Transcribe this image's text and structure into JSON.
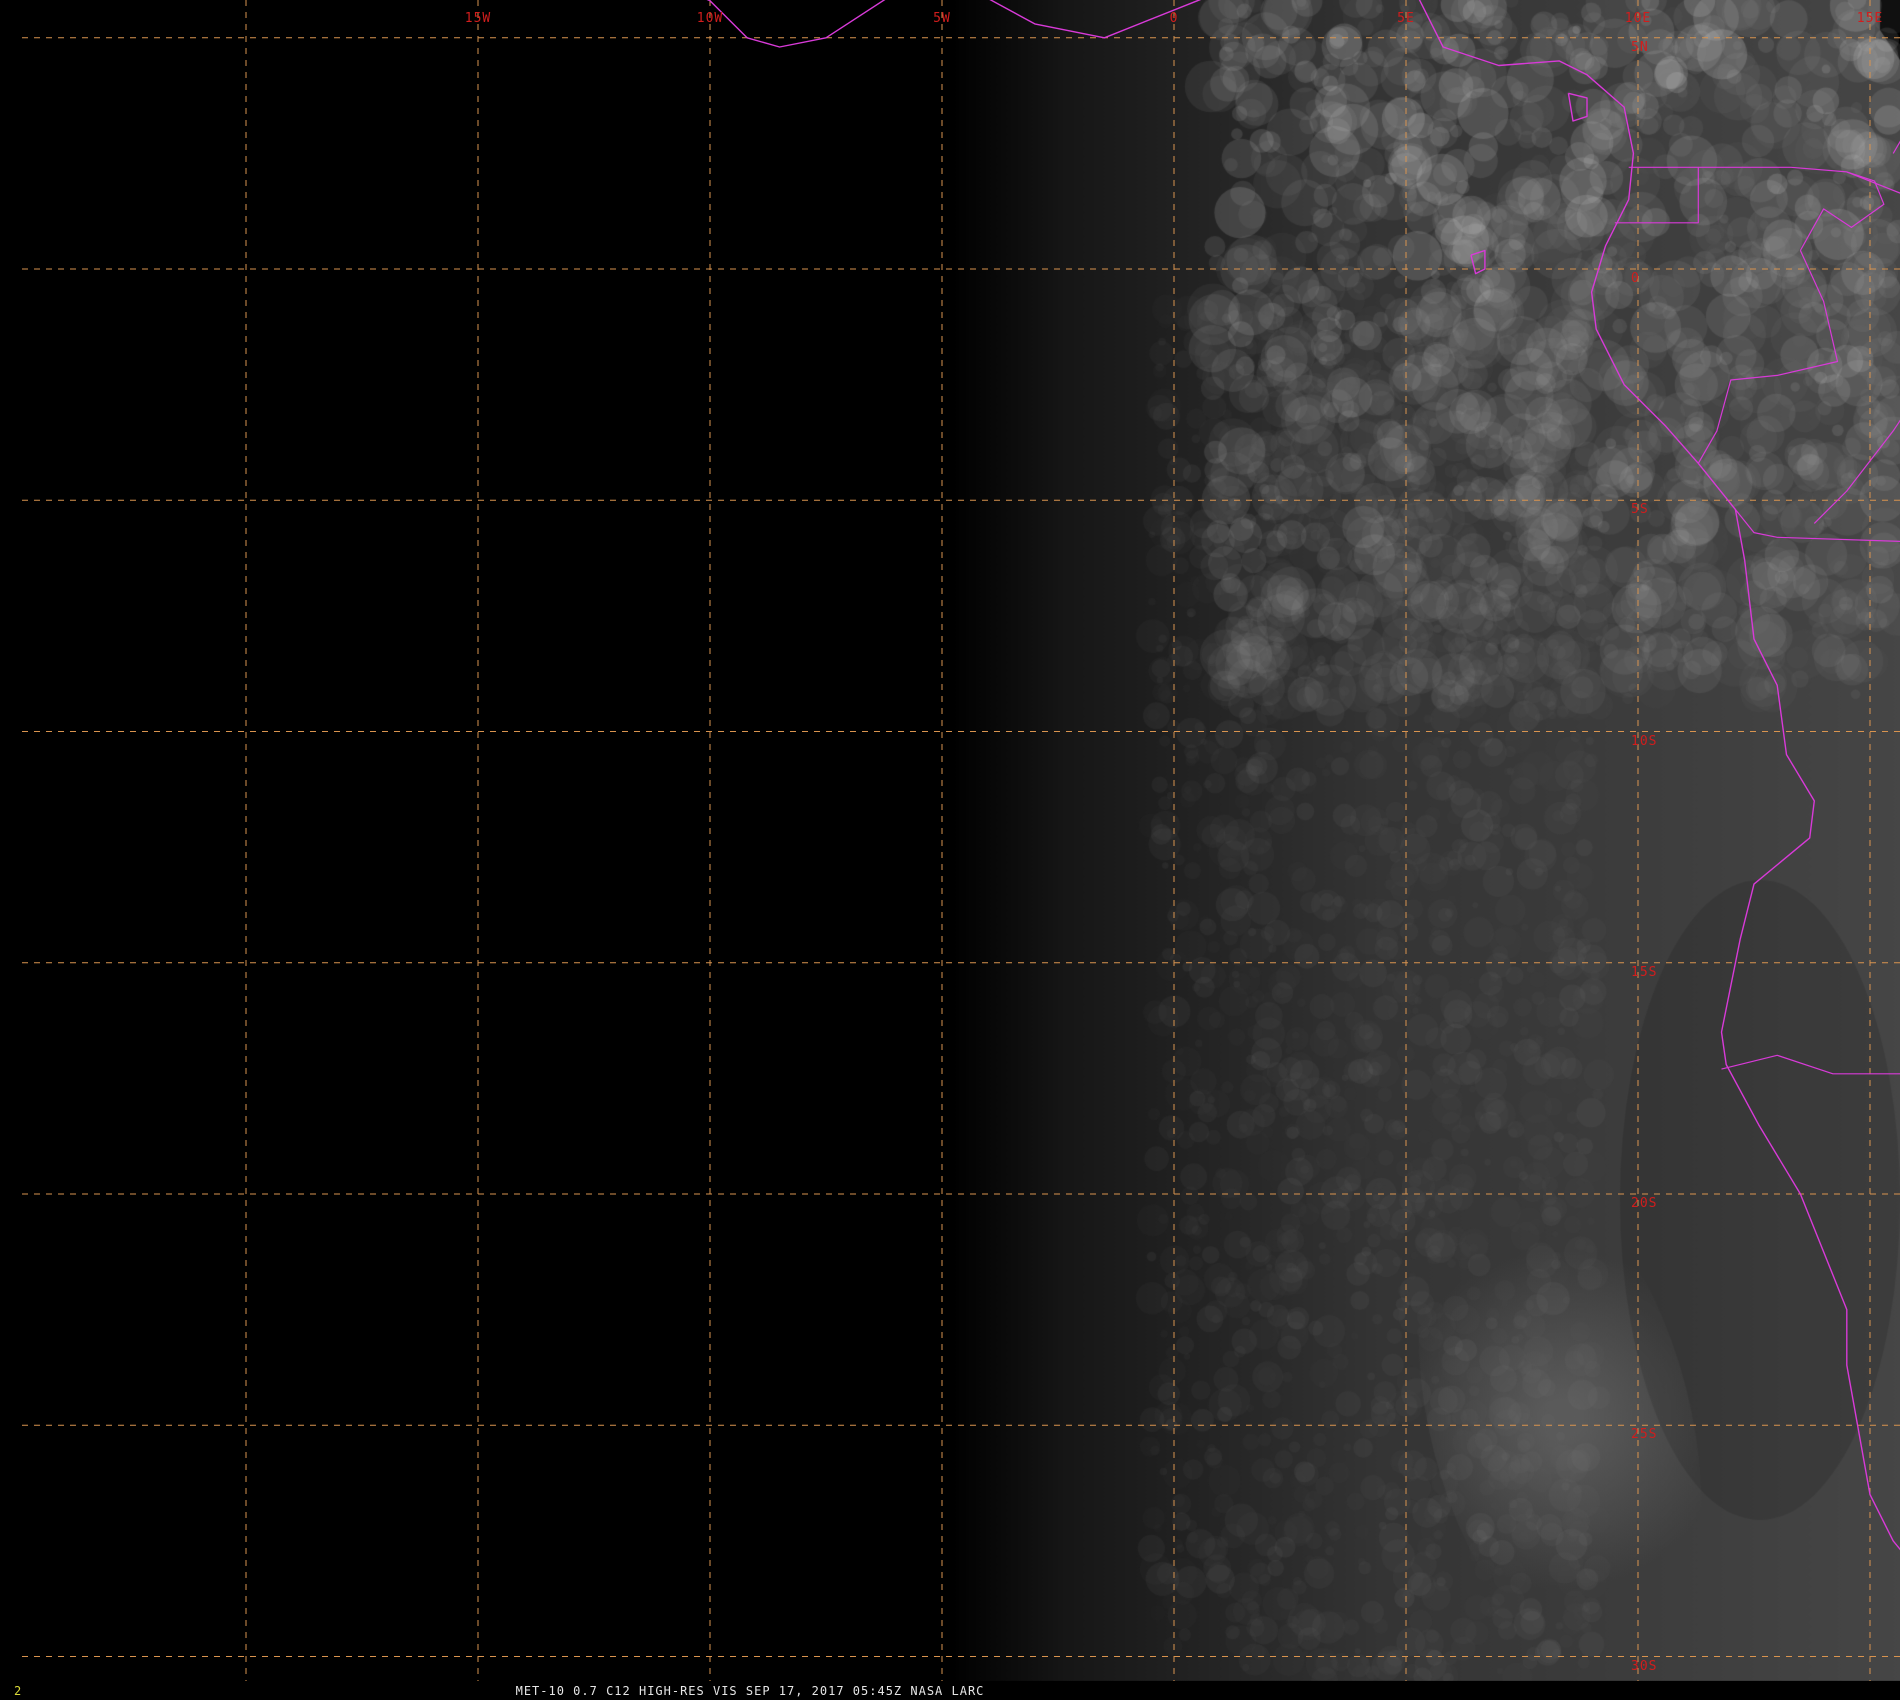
{
  "colors": {
    "background": "#000000",
    "grid_line": "#d9944f",
    "coastline": "#d83ad8",
    "grid_label": "#d11d1d",
    "frame_number": "#d8d838",
    "caption_text": "#e6e6e6"
  },
  "map": {
    "projection_note_visible": false,
    "lon_min": -20,
    "lon_max": 20,
    "lat_min": -31.5,
    "lat_max": 6.5,
    "longitude_labels": [
      {
        "lon": -15,
        "text": "15W"
      },
      {
        "lon": -10,
        "text": "10W"
      },
      {
        "lon": -5,
        "text": "5W"
      },
      {
        "lon": 0,
        "text": "0"
      },
      {
        "lon": 5,
        "text": "5E"
      },
      {
        "lon": 10,
        "text": "10E"
      },
      {
        "lon": 15,
        "text": "15E"
      }
    ],
    "latitude_labels": [
      {
        "lat": 5,
        "text": "5N"
      },
      {
        "lat": 0,
        "text": "0"
      },
      {
        "lat": -5,
        "text": "5S"
      },
      {
        "lat": -10,
        "text": "10S"
      },
      {
        "lat": -15,
        "text": "15S"
      },
      {
        "lat": -20,
        "text": "20S"
      },
      {
        "lat": -25,
        "text": "25S"
      },
      {
        "lat": -30,
        "text": "30S"
      }
    ],
    "grid_longitudes": [
      -20,
      -15,
      -10,
      -5,
      0,
      5,
      10,
      15
    ],
    "grid_latitudes": [
      5,
      0,
      -5,
      -10,
      -15,
      -20,
      -25,
      -30
    ],
    "coastlines": [
      {
        "name": "west-africa-gulf-of-guinea-coast",
        "points": [
          [
            -5.2,
            6.5
          ],
          [
            -7.5,
            5.0
          ],
          [
            -8.5,
            4.8
          ],
          [
            -9.2,
            5.0
          ],
          [
            -10.0,
            5.8
          ],
          [
            -11.5,
            6.5
          ]
        ]
      },
      {
        "name": "ghana-togo-benin-coast",
        "points": [
          [
            -5.2,
            6.5
          ],
          [
            -3.0,
            5.3
          ],
          [
            -1.5,
            5.0
          ],
          [
            0.5,
            5.8
          ],
          [
            1.5,
            6.2
          ],
          [
            3.0,
            6.4
          ],
          [
            4.5,
            6.1
          ]
        ]
      },
      {
        "name": "nigeria-cameroon-gabon-coast",
        "points": [
          [
            5.2,
            6.0
          ],
          [
            5.8,
            4.8
          ],
          [
            7.0,
            4.4
          ],
          [
            8.3,
            4.5
          ],
          [
            8.9,
            4.2
          ],
          [
            9.7,
            3.5
          ],
          [
            9.9,
            2.5
          ],
          [
            9.8,
            1.5
          ],
          [
            9.3,
            0.5
          ],
          [
            9.0,
            -0.5
          ],
          [
            9.1,
            -1.3
          ],
          [
            9.7,
            -2.5
          ],
          [
            10.6,
            -3.4
          ],
          [
            11.3,
            -4.2
          ],
          [
            12.1,
            -5.2
          ],
          [
            12.3,
            -6.3
          ],
          [
            12.5,
            -8.0
          ],
          [
            13.0,
            -9.0
          ],
          [
            13.2,
            -10.5
          ],
          [
            13.8,
            -11.5
          ],
          [
            13.7,
            -12.3
          ],
          [
            12.5,
            -13.3
          ],
          [
            12.2,
            -14.5
          ],
          [
            11.8,
            -16.5
          ],
          [
            11.9,
            -17.2
          ],
          [
            12.6,
            -18.5
          ],
          [
            13.5,
            -20.0
          ],
          [
            14.5,
            -22.5
          ],
          [
            14.5,
            -23.7
          ],
          [
            15.0,
            -26.5
          ],
          [
            15.5,
            -27.5
          ],
          [
            16.4,
            -28.6
          ],
          [
            17.0,
            -29.5
          ],
          [
            17.4,
            -30.8
          ],
          [
            17.8,
            -31.5
          ]
        ]
      },
      {
        "name": "bioko-island",
        "points": [
          [
            8.5,
            3.8
          ],
          [
            8.9,
            3.7
          ],
          [
            8.9,
            3.3
          ],
          [
            8.6,
            3.2
          ],
          [
            8.5,
            3.8
          ]
        ]
      },
      {
        "name": "sao-tome-island",
        "points": [
          [
            6.4,
            0.3
          ],
          [
            6.7,
            0.4
          ],
          [
            6.7,
            0.0
          ],
          [
            6.5,
            -0.1
          ],
          [
            6.4,
            0.3
          ]
        ]
      }
    ],
    "borders": [
      {
        "name": "cameroon-equatorial-guinea-gabon",
        "points": [
          [
            9.8,
            2.2
          ],
          [
            11.3,
            2.2
          ],
          [
            11.3,
            1.0
          ],
          [
            9.5,
            1.0
          ]
        ]
      },
      {
        "name": "cameroon-congo",
        "points": [
          [
            11.3,
            2.2
          ],
          [
            13.3,
            2.2
          ],
          [
            14.5,
            2.1
          ],
          [
            15.1,
            1.9
          ],
          [
            15.3,
            1.4
          ],
          [
            14.6,
            0.9
          ],
          [
            14.0,
            1.3
          ],
          [
            13.5,
            0.4
          ]
        ]
      },
      {
        "name": "gabon-congo",
        "points": [
          [
            13.5,
            0.4
          ],
          [
            14.0,
            -0.7
          ],
          [
            14.3,
            -2.0
          ],
          [
            13.0,
            -2.3
          ],
          [
            12.0,
            -2.4
          ],
          [
            11.7,
            -3.5
          ],
          [
            11.3,
            -4.2
          ]
        ]
      },
      {
        "name": "drc-angola-north",
        "points": [
          [
            12.1,
            -5.2
          ],
          [
            12.5,
            -5.7
          ],
          [
            13.0,
            -5.8
          ],
          [
            16.0,
            -5.9
          ],
          [
            17.5,
            -8.0
          ],
          [
            18.5,
            -8.0
          ],
          [
            19.5,
            -7.0
          ],
          [
            20.0,
            -7.0
          ]
        ]
      },
      {
        "name": "angola-zambia",
        "points": [
          [
            17.6,
            -8.1
          ],
          [
            18.0,
            -9.0
          ],
          [
            18.5,
            -10.5
          ],
          [
            19.5,
            -11.5
          ],
          [
            21.0,
            -12.0
          ]
        ]
      },
      {
        "name": "angola-namibia",
        "points": [
          [
            11.8,
            -17.3
          ],
          [
            13.0,
            -17.0
          ],
          [
            14.2,
            -17.4
          ],
          [
            16.0,
            -17.4
          ],
          [
            18.0,
            -17.4
          ],
          [
            20.0,
            -17.9
          ],
          [
            21.0,
            -18.0
          ]
        ]
      },
      {
        "name": "namibia-south-africa",
        "points": [
          [
            16.4,
            -28.6
          ],
          [
            17.4,
            -28.3
          ],
          [
            18.2,
            -28.9
          ],
          [
            19.5,
            -28.6
          ],
          [
            20.0,
            -28.4
          ],
          [
            20.0,
            -25.0
          ],
          [
            21.0,
            -24.5
          ]
        ]
      },
      {
        "name": "congo-drc-river",
        "points": [
          [
            14.5,
            2.1
          ],
          [
            16.0,
            1.5
          ],
          [
            17.0,
            -0.5
          ],
          [
            16.5,
            -2.0
          ],
          [
            15.5,
            -3.5
          ],
          [
            14.5,
            -4.8
          ],
          [
            13.8,
            -5.5
          ]
        ]
      },
      {
        "name": "drc-eastern",
        "points": [
          [
            15.5,
            2.5
          ],
          [
            16.2,
            3.7
          ],
          [
            17.5,
            5.0
          ],
          [
            18.5,
            4.5
          ],
          [
            19.0,
            3.5
          ]
        ]
      }
    ]
  },
  "frame_number": "2",
  "caption": "MET-10 0.7 C12 HIGH-RES VIS   SEP 17, 2017 05:45Z   NASA LARC"
}
